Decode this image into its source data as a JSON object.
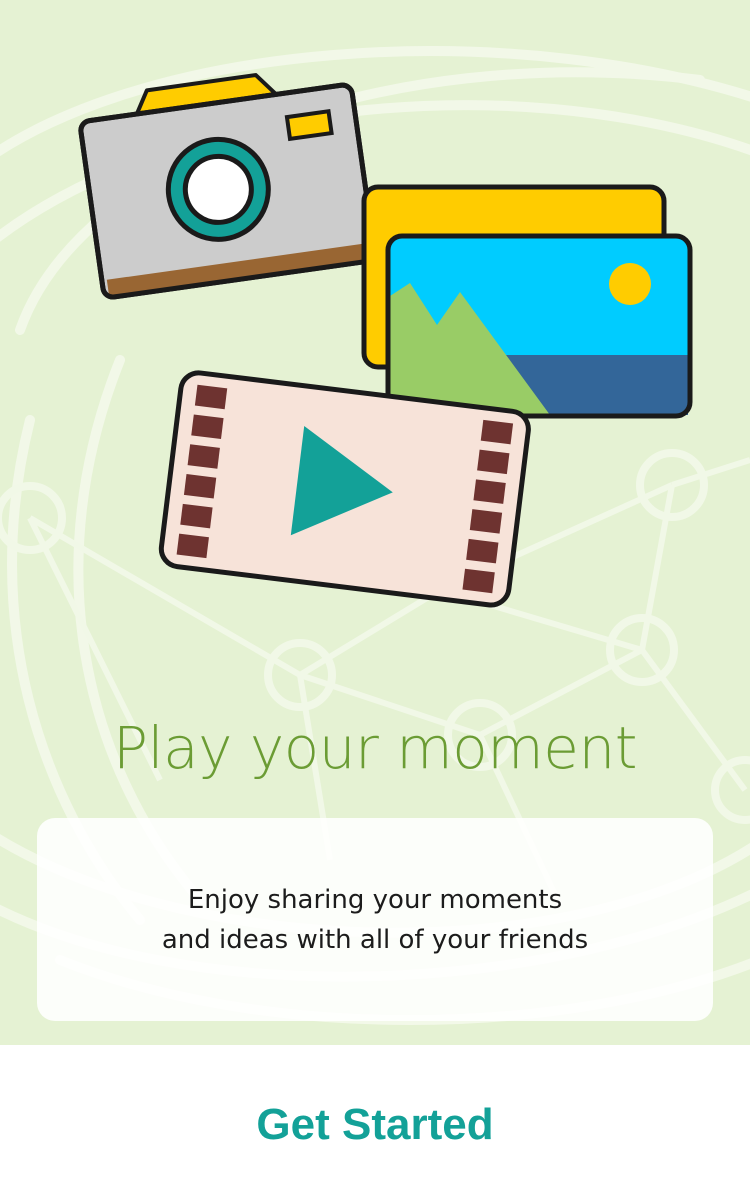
{
  "onboarding": {
    "title": "Play your moment",
    "description_lines": [
      "Enjoy sharing your moments",
      "and ideas with all of your friends"
    ],
    "cta_label": "Get Started"
  },
  "colors": {
    "background": "#e5f2d3",
    "network_lines": "#f3f9ea",
    "title": "#6b9c34",
    "cta": "#13a198",
    "camera_body": "#cccccc",
    "camera_top": "#ffcc00",
    "camera_lens_ring": "#13a198",
    "photo_sky": "#00ccff",
    "photo_sea": "#336699",
    "photo_hills": "#99cc66",
    "photo_sun": "#ffcc00",
    "video_card": "#f7e3d9",
    "film_holes": "#6e3330",
    "play_triangle": "#13a198"
  },
  "icons": [
    "camera-icon",
    "photo-gallery-icon",
    "video-player-icon",
    "play-icon"
  ]
}
